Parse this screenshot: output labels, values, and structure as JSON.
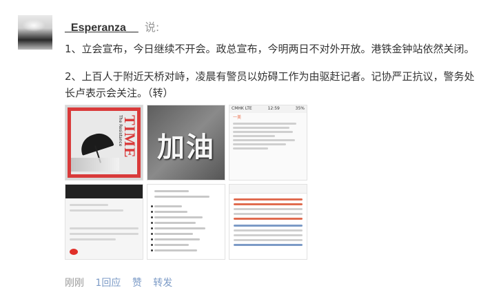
{
  "post": {
    "username": "_Esperanza__",
    "said_suffix": "说:",
    "paragraph1": "1、立会宣布，今日继续不开会。政总宣布，今明两日不对外开放。港铁金钟站依然关闭。",
    "paragraph2": "2、上百人于附近天桥对峙，凌晨有警员以妨碍工作为由驱赶记者。记协严正抗议，警务处长卢表示会关注。（转）"
  },
  "images": {
    "cover_word": "TIME",
    "cover_subtitle": "The Resistance",
    "calligraphy": "加油",
    "phone_status_left": "CMHK  LTE",
    "phone_status_center": "12:59",
    "phone_status_right": "35%",
    "post_user": "一美"
  },
  "footer": {
    "time": "刚刚",
    "reply": "1回应",
    "like": "赞",
    "repost": "转发"
  }
}
